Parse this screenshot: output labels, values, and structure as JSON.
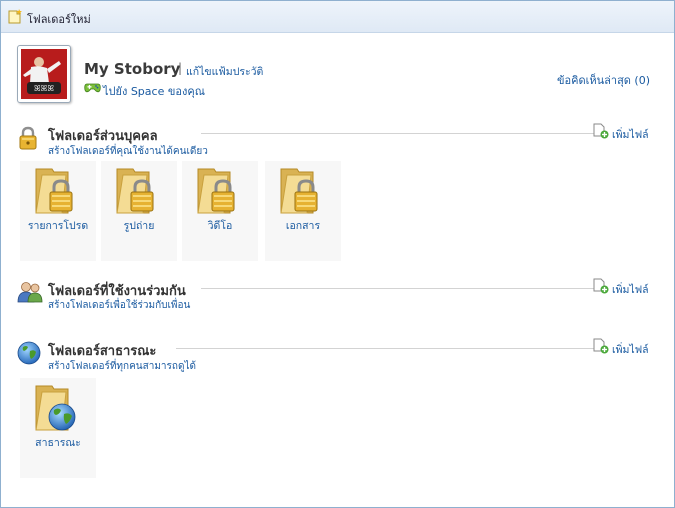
{
  "window": {
    "title": "โฟลเดอร์ใหม่"
  },
  "profile": {
    "name": "My Stobory",
    "separator": "|",
    "edit_profile": "แก้ไขแฟ้มประวัติ",
    "go_to_space": "ไปยัง Space ของคุณ",
    "recent_comments": "ข้อคิดเห็นล่าสุด (0)"
  },
  "sections": {
    "personal": {
      "title": "โฟลเดอร์ส่วนบุคคล",
      "subtitle": "สร้างโฟลเดอร์ที่คุณใช้งานได้คนเดียว",
      "add_file": "เพิ่มไฟล์",
      "folders": [
        "รายการโปรด",
        "รูปถ่าย",
        "วิดีโอ",
        "เอกสาร"
      ]
    },
    "shared": {
      "title": "โฟลเดอร์ที่ใช้งานร่วมกัน",
      "subtitle": "สร้างโฟลเดอร์เพื่อใช้ร่วมกับเพื่อน",
      "add_file": "เพิ่มไฟล์"
    },
    "public": {
      "title": "โฟลเดอร์สาธารณะ",
      "subtitle": "สร้างโฟลเดอร์ที่ทุกคนสามารถดูได้",
      "add_file": "เพิ่มไฟล์",
      "folders": [
        "สาธารณะ"
      ]
    }
  },
  "icons": {
    "title": "new-folder-icon",
    "space": "space-controller-icon",
    "personal": "lock-icon",
    "shared": "people-icon",
    "public": "globe-icon",
    "add": "add-file-icon",
    "private_folder": "locked-folder-icon",
    "public_folder": "globe-folder-icon"
  },
  "colors": {
    "link": "#1a5aa0",
    "title_bar": "#dfe9f5",
    "border": "#8fb0cf"
  }
}
